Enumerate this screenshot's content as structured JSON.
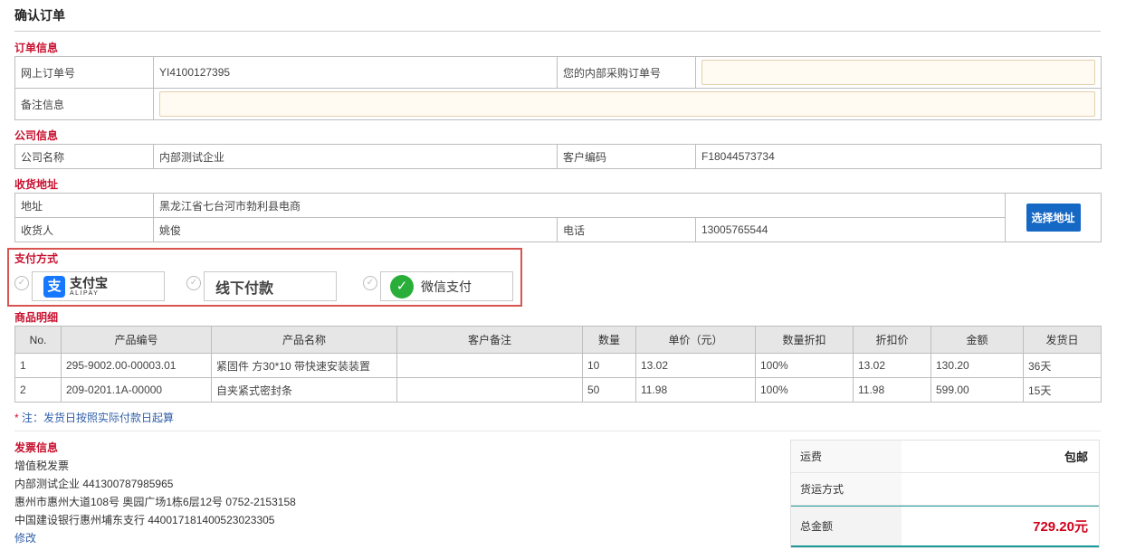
{
  "page_title": "确认订单",
  "order_info": {
    "title": "订单信息",
    "online_order_label": "网上订单号",
    "online_order_value": "YI4100127395",
    "internal_po_label": "您的内部采购订单号",
    "internal_po_value": "",
    "remark_label": "备注信息",
    "remark_value": ""
  },
  "company_info": {
    "title": "公司信息",
    "company_label": "公司名称",
    "company_value": "内部测试企业",
    "customer_code_label": "客户编码",
    "customer_code_value": "F18044573734"
  },
  "shipping_address": {
    "title": "收货地址",
    "address_label": "地址",
    "address_value": "黑龙江省七台河市勃利县电商",
    "receiver_label": "收货人",
    "receiver_value": "姚俊",
    "phone_label": "电话",
    "phone_value": "13005765544",
    "select_button": "选择地址"
  },
  "payment": {
    "title": "支付方式",
    "options": [
      {
        "name": "alipay",
        "label_cn": "支付宝",
        "label_en": "ALIPAY",
        "logo_glyph": "支"
      },
      {
        "name": "offline",
        "label": "线下付款"
      },
      {
        "name": "wechat",
        "label": "微信支付",
        "logo_glyph": "✓"
      }
    ],
    "check_glyph": "✓"
  },
  "items": {
    "title": "商品明细",
    "headers": [
      "No.",
      "产品编号",
      "产品名称",
      "客户备注",
      "数量",
      "单价（元）",
      "数量折扣",
      "折扣价",
      "金额",
      "发货日"
    ],
    "rows": [
      {
        "no": "1",
        "code": "295-9002.00-00003.01",
        "name": "紧固件 方30*10 带快速安装装置",
        "remark": "",
        "qty": "10",
        "price": "13.02",
        "discount": "100%",
        "discount_price": "13.02",
        "amount": "130.20",
        "ship": "36天"
      },
      {
        "no": "2",
        "code": "209-0201.1A-00000",
        "name": "自夹紧式密封条",
        "remark": "",
        "qty": "50",
        "price": "11.98",
        "discount": "100%",
        "discount_price": "11.98",
        "amount": "599.00",
        "ship": "15天"
      }
    ]
  },
  "note": {
    "star": "*",
    "text": "注：发货日按照实际付款日起算"
  },
  "invoice": {
    "title": "发票信息",
    "type": "增值税发票",
    "company_line": "内部测试企业  441300787985965",
    "address_line": "惠州市惠州大道108号  奥园广场1栋6层12号  0752-2153158",
    "bank_line": "中国建设银行惠州埔东支行  440017181400523023305",
    "edit": "修改"
  },
  "summary": {
    "freight_label": "运费",
    "freight_value": "包邮",
    "shipping_method_label": "货运方式",
    "shipping_method_value": "",
    "total_label": "总金额",
    "total_value": "729.20元"
  },
  "colors": {
    "section_title": "#c8102e",
    "button": "#1668c5",
    "highlight_border": "#d9534f",
    "link": "#2f5fa8",
    "total": "#d0021b"
  }
}
